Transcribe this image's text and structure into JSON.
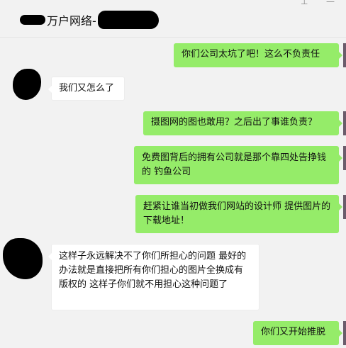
{
  "header": {
    "title": "万户网络-",
    "pin_icon": "pin-icon",
    "minimize_icon": "minimize-icon"
  },
  "messages": [
    {
      "side": "out",
      "text": "你们公司太坑了吧！这么不负责任"
    },
    {
      "side": "in",
      "text": "我们又怎么了"
    },
    {
      "side": "out",
      "text": "摄图网的图也敢用？之后出了事谁负责？"
    },
    {
      "side": "out",
      "text": "免费图背后的拥有公司就是那个靠四处告挣钱的   钓鱼公司"
    },
    {
      "side": "out",
      "text": "赶紧让谁当初做我们网站的设计师   提供图片的下载地址！"
    },
    {
      "side": "in",
      "text": "这样子永远解决不了你们所担心的问题  最好的办法就是直接把所有你们担心的图片全换成有版权的 这样子你们就不用担心这种问题了"
    },
    {
      "side": "out",
      "text": "你们又开始推脱"
    }
  ],
  "colors": {
    "outgoing_bubble": "#95ec69",
    "incoming_bubble": "#ffffff",
    "background": "#f2f2f2"
  }
}
